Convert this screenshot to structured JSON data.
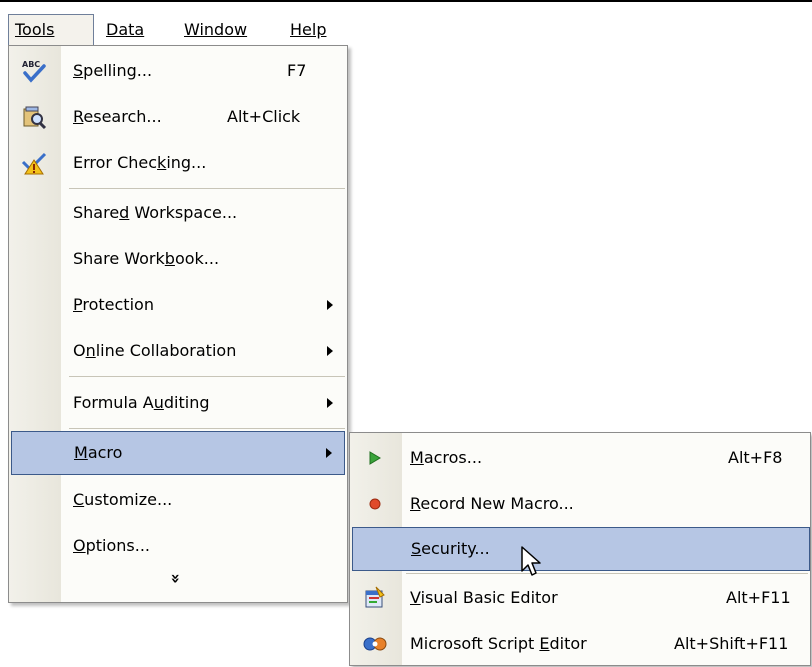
{
  "menubar": {
    "tools": "Tools",
    "data": "Data",
    "window": "Window",
    "help": "Help"
  },
  "tools_menu": {
    "spelling": {
      "pre": "",
      "key": "S",
      "post": "pelling...",
      "shortcut": "F7",
      "icon": "spelling-abc-check-icon"
    },
    "research": {
      "pre": "",
      "key": "R",
      "post": "esearch...",
      "shortcut": "Alt+Click",
      "icon": "research-book-magnifier-icon"
    },
    "error_checking": {
      "pre": "Error Chec",
      "key": "k",
      "post": "ing...",
      "icon": "error-checking-icon"
    },
    "shared_workspace": {
      "pre": "Share",
      "key": "d",
      "post": " Workspace..."
    },
    "share_workbook": {
      "pre": "Share Work",
      "key": "b",
      "post": "ook..."
    },
    "protection": {
      "pre": "",
      "key": "P",
      "post": "rotection"
    },
    "online_collaboration": {
      "pre": "O",
      "key": "n",
      "post": "line Collaboration"
    },
    "formula_auditing": {
      "pre": "Formula A",
      "key": "u",
      "post": "diting"
    },
    "macro": {
      "pre": "",
      "key": "M",
      "post": "acro"
    },
    "customize": {
      "pre": "",
      "key": "C",
      "post": "ustomize..."
    },
    "options": {
      "pre": "",
      "key": "O",
      "post": "ptions..."
    },
    "expand": "»"
  },
  "macro_menu": {
    "macros": {
      "pre": "",
      "key": "M",
      "post": "acros...",
      "shortcut": "Alt+F8",
      "icon": "play-icon"
    },
    "record": {
      "pre": "",
      "key": "R",
      "post": "ecord New Macro...",
      "icon": "record-icon"
    },
    "security": {
      "pre": "",
      "key": "S",
      "post": "ecurity...",
      "icon": ""
    },
    "vbe": {
      "pre": "",
      "key": "V",
      "post": "isual Basic Editor",
      "shortcut": "Alt+F11",
      "icon": "visual-basic-editor-icon"
    },
    "script_editor": {
      "pre": "Microsoft Script ",
      "key": "E",
      "post": "ditor",
      "shortcut": "Alt+Shift+F11",
      "icon": "script-editor-icon"
    }
  },
  "colors": {
    "highlight": "#b6c6e4",
    "highlight_border": "#3c5a8a",
    "menu_bg": "#fcfcf9"
  }
}
